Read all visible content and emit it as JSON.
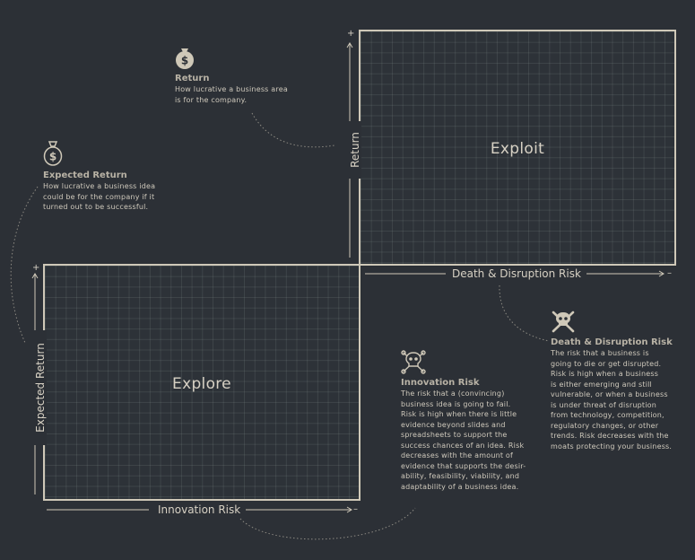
{
  "quadrants": {
    "exploit": {
      "title": "Exploit"
    },
    "explore": {
      "title": "Explore"
    }
  },
  "axes": {
    "return": {
      "label": "Return",
      "plus": "+"
    },
    "death_risk": {
      "label": "Death & Disruption Risk",
      "minus": "–"
    },
    "expected_return": {
      "label": "Expected Return",
      "plus": "+"
    },
    "innovation_risk": {
      "label": "Innovation Risk",
      "minus": "–"
    }
  },
  "annotations": {
    "return": {
      "icon": "money-bag-icon",
      "title": "Return",
      "lines": [
        "How lucrative a business area",
        "is for the company."
      ]
    },
    "expected_return": {
      "icon": "money-bag-icon",
      "title": "Expected Return",
      "lines": [
        "How lucrative a business idea",
        "could be for the company if it",
        "turned out to be successful."
      ]
    },
    "innovation_risk": {
      "icon": "skull-crossbones-outline-icon",
      "title": "Innovation Risk",
      "lines": [
        "The risk that a (convincing)",
        "business idea is going to fail.",
        "Risk is high when there is little",
        "evidence beyond slides and",
        "spreadsheets to support the",
        "success chances of an idea. Risk",
        "decreases with the amount of",
        "evidence that supports the desir-",
        "ability, feasibility, viability, and",
        "adaptability of a business idea."
      ]
    },
    "death_risk": {
      "icon": "skull-crossbones-icon",
      "title": "Death & Disruption Risk",
      "lines": [
        "The risk that a business is",
        "going to die or get disrupted.",
        "Risk is high when a business",
        "is either emerging and still",
        "vulnerable, or when a business",
        "is under threat of disruption",
        "from technology, competition,",
        "regulatory changes, or other",
        "trends. Risk decreases with the",
        "moats protecting your business."
      ]
    }
  },
  "colors": {
    "background": "#2c3036",
    "frame": "#cfc8b8",
    "text": "#d7d1c4",
    "icon": "#cfc8b8"
  }
}
